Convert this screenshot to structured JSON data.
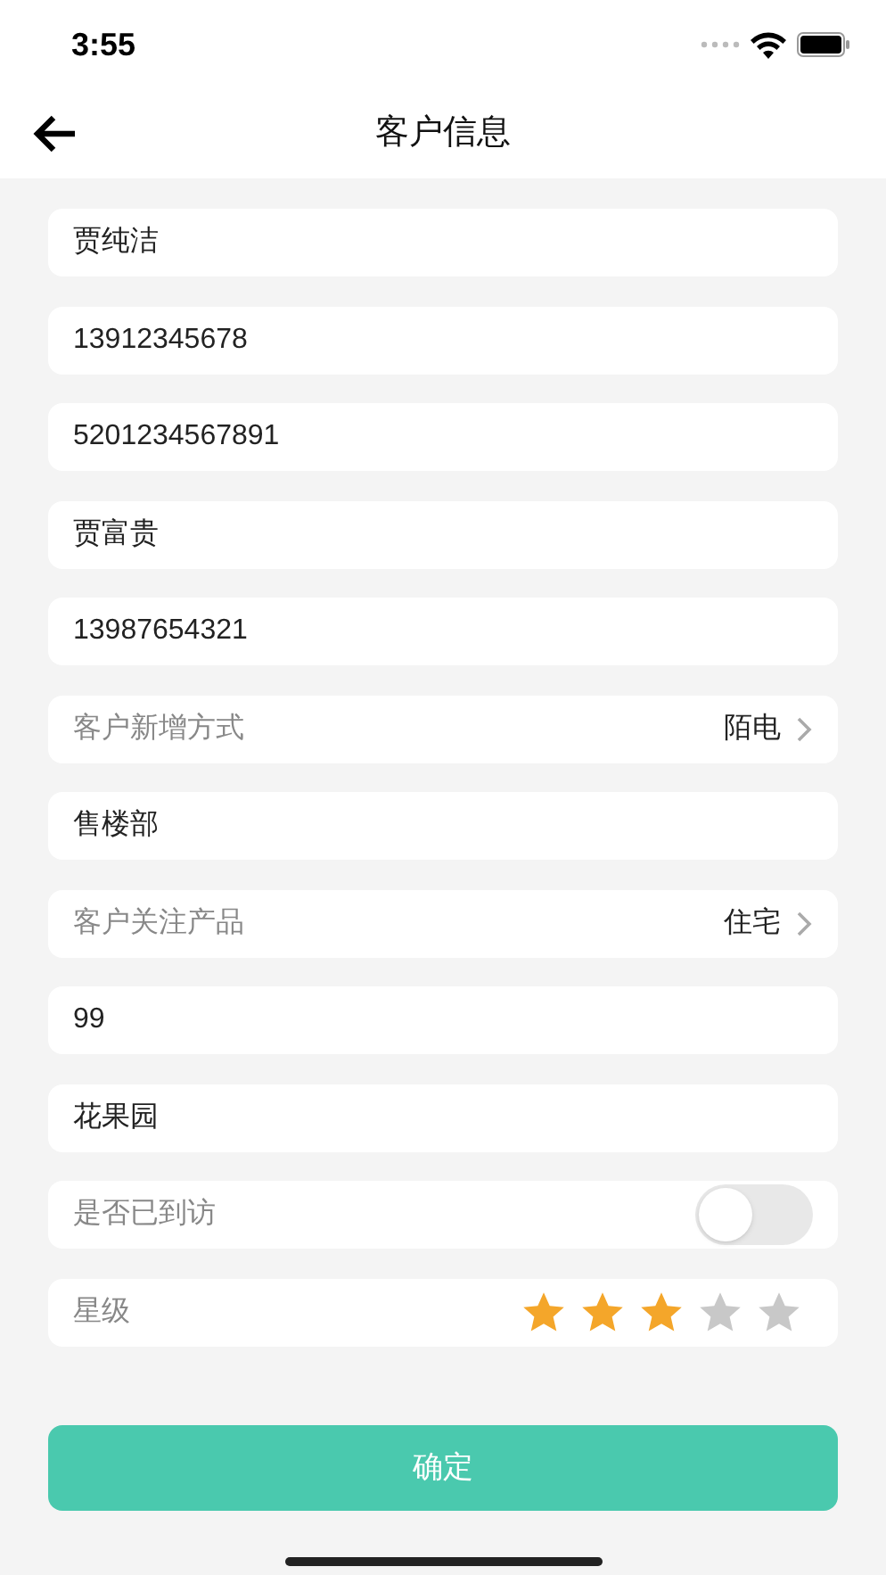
{
  "status_bar": {
    "time": "3:55"
  },
  "nav": {
    "title": "客户信息"
  },
  "fields": [
    {
      "kind": "text",
      "value": "贾纯洁"
    },
    {
      "kind": "text",
      "value": "13912345678"
    },
    {
      "kind": "text",
      "value": "5201234567891"
    },
    {
      "kind": "text",
      "value": "贾富贵"
    },
    {
      "kind": "text",
      "value": "13987654321"
    },
    {
      "kind": "select",
      "label": "客户新增方式",
      "value": "陌电"
    },
    {
      "kind": "text",
      "value": "售楼部"
    },
    {
      "kind": "select",
      "label": "客户关注产品",
      "value": "住宅"
    },
    {
      "kind": "text",
      "value": "99"
    },
    {
      "kind": "text",
      "value": "花果园"
    },
    {
      "kind": "toggle",
      "label": "是否已到访",
      "on": false
    },
    {
      "kind": "rating",
      "label": "星级",
      "stars": 3
    }
  ],
  "confirm_button": "确定"
}
